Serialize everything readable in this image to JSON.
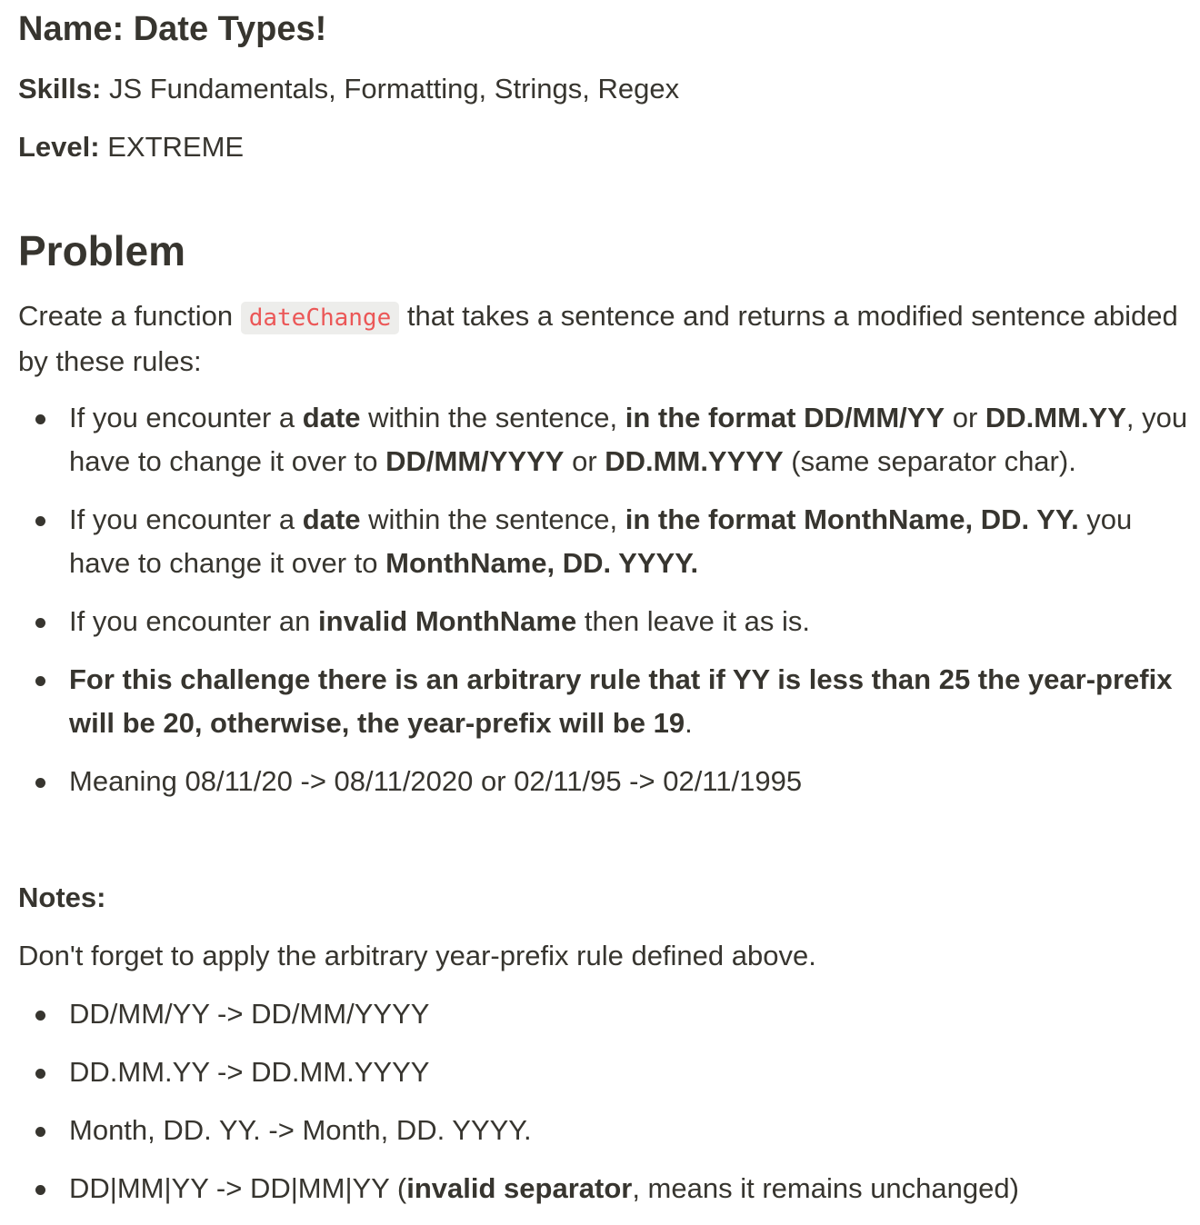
{
  "header": {
    "title": "Name: Date Types!",
    "skills_label": "Skills:",
    "skills_value": " JS Fundamentals, Formatting, Strings, Regex",
    "level_label": "Level:",
    "level_value": " EXTREME"
  },
  "problem": {
    "heading": "Problem",
    "intro_before": "Create a function ",
    "function_name": "dateChange",
    "intro_after": " that takes a sentence and returns a modified sentence abided by these rules:",
    "rules": [
      {
        "p1": "If you encounter a ",
        "b1": "date",
        "p2": " within the sentence, ",
        "b2": "in the format DD/MM/YY",
        "p3": " or ",
        "b3": "DD.MM.YY",
        "p4": ", you have to change it over to ",
        "b4": "DD/MM/YYYY",
        "p5": " or ",
        "b5": "DD.MM.YYYY",
        "p6": " (same separator char)."
      },
      {
        "p1": "If you encounter a ",
        "b1": "date",
        "p2": " within the sentence, ",
        "b2": "in the format MonthName, DD. YY.",
        "p3": " you have to change it over to ",
        "b3": "MonthName, DD. YYYY."
      },
      {
        "p1": "If you encounter an ",
        "b1": "invalid MonthName",
        "p2": " then leave it as is."
      },
      {
        "b1": "For this challenge there is an arbitrary rule that if YY is less than 25 the year-prefix will be 20, otherwise, the year-prefix will be 19",
        "p1": "."
      },
      {
        "p1": "Meaning 08/11/20 -> 08/11/2020 or 02/11/95 -> 02/11/1995"
      }
    ]
  },
  "notes": {
    "title": "Notes:",
    "text": "Don't forget to apply the arbitrary year-prefix rule defined above.",
    "items": [
      {
        "p1": "DD/MM/YY -> DD/MM/YYYY"
      },
      {
        "p1": "DD.MM.YY -> DD.MM.YYYY"
      },
      {
        "p1": "Month, DD. YY. -> Month, DD. YYYY."
      },
      {
        "p1": "DD|MM|YY -> DD|MM|YY (",
        "b1": "invalid separator",
        "p2": ", means it remains unchanged)"
      }
    ]
  }
}
